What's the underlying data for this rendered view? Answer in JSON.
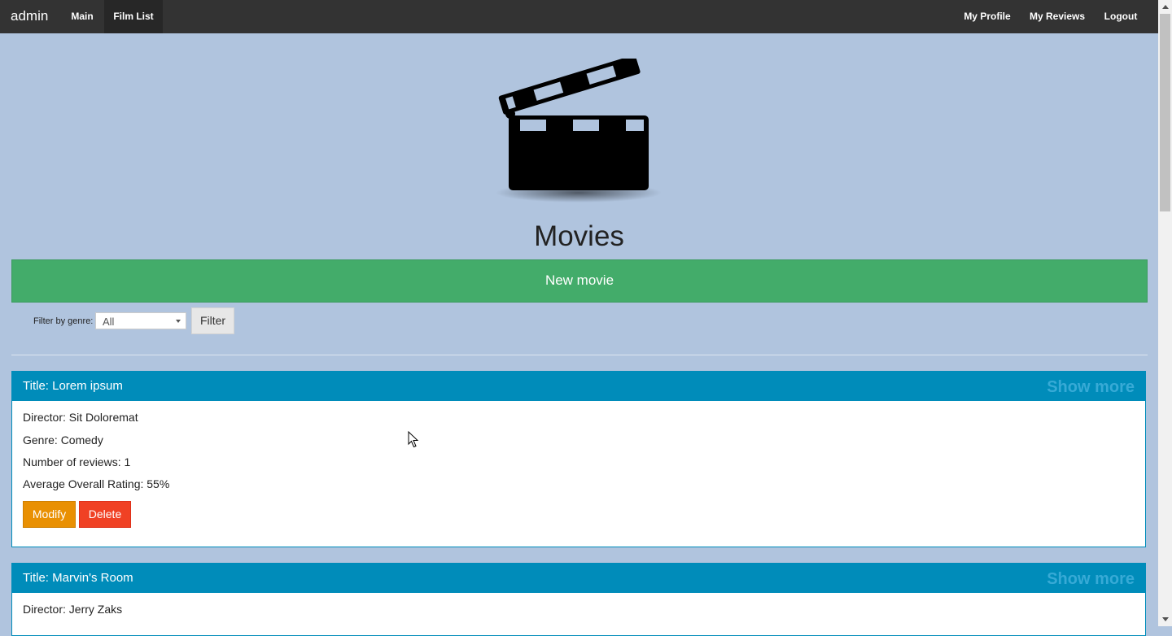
{
  "nav": {
    "brand": "admin",
    "main": "Main",
    "film_list": "Film List",
    "my_profile": "My Profile",
    "my_reviews": "My Reviews",
    "logout": "Logout"
  },
  "header": {
    "logo_icon": "clapperboard-icon",
    "title": "Movies"
  },
  "actions": {
    "new_movie": "New movie"
  },
  "filter": {
    "label": "Filter by genre:",
    "selected": "All",
    "button": "Filter"
  },
  "movies": [
    {
      "title_prefix": "Title: ",
      "title": "Lorem ipsum",
      "show_more": "Show more",
      "director": "Director: Sit Doloremat",
      "genre": "Genre: Comedy",
      "reviews": "Number of reviews: 1",
      "rating": "Average Overall Rating: 55%",
      "modify": "Modify",
      "delete": "Delete"
    },
    {
      "title_prefix": "Title: ",
      "title": "Marvin's Room",
      "show_more": "Show more",
      "director": "Director: Jerry Zaks"
    }
  ],
  "colors": {
    "background": "#b0c4de",
    "navbar": "#333333",
    "success": "#43ac6a",
    "panel_header": "#008cba",
    "modify": "#e99002",
    "delete": "#f04124"
  }
}
